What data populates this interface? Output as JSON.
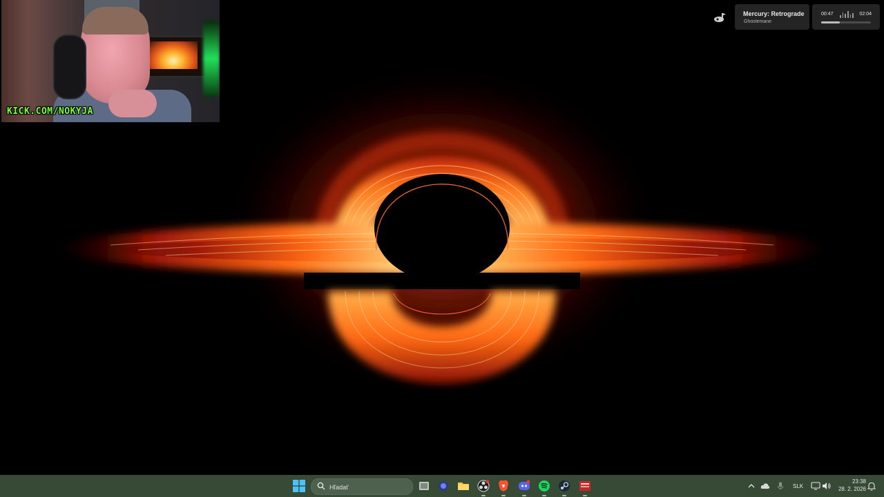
{
  "webcam": {
    "overlay_text": "KICK.COM/NOKYJA"
  },
  "music_widget": {
    "track_title": "Mercury: Retrograde",
    "artist": "Ghostemane",
    "elapsed": "00:47",
    "total": "02:04",
    "progress_fraction": 0.38,
    "icon": "music-note-icon"
  },
  "taskbar": {
    "search": {
      "placeholder": "Hľadať"
    },
    "apps": [
      {
        "name": "start-button",
        "icon": "windows-logo-icon"
      },
      {
        "name": "task-view",
        "icon": "task-view-icon"
      },
      {
        "name": "app-bubble",
        "icon": "bubble-icon"
      },
      {
        "name": "file-explorer",
        "icon": "folder-icon"
      },
      {
        "name": "obs",
        "icon": "obs-icon"
      },
      {
        "name": "brave",
        "icon": "brave-icon"
      },
      {
        "name": "discord",
        "icon": "discord-icon"
      },
      {
        "name": "spotify",
        "icon": "spotify-icon"
      },
      {
        "name": "steam",
        "icon": "steam-icon"
      },
      {
        "name": "app-red",
        "icon": "red-app-icon"
      }
    ],
    "tray": {
      "language": "SLK",
      "time": "23:38",
      "date": "28. 2. 2026"
    }
  },
  "colors": {
    "taskbar_bg": "#364a36",
    "disk_orange": "#ff6a14",
    "disk_yellow": "#ffd27a",
    "webcam_label": "#7cff3c"
  }
}
